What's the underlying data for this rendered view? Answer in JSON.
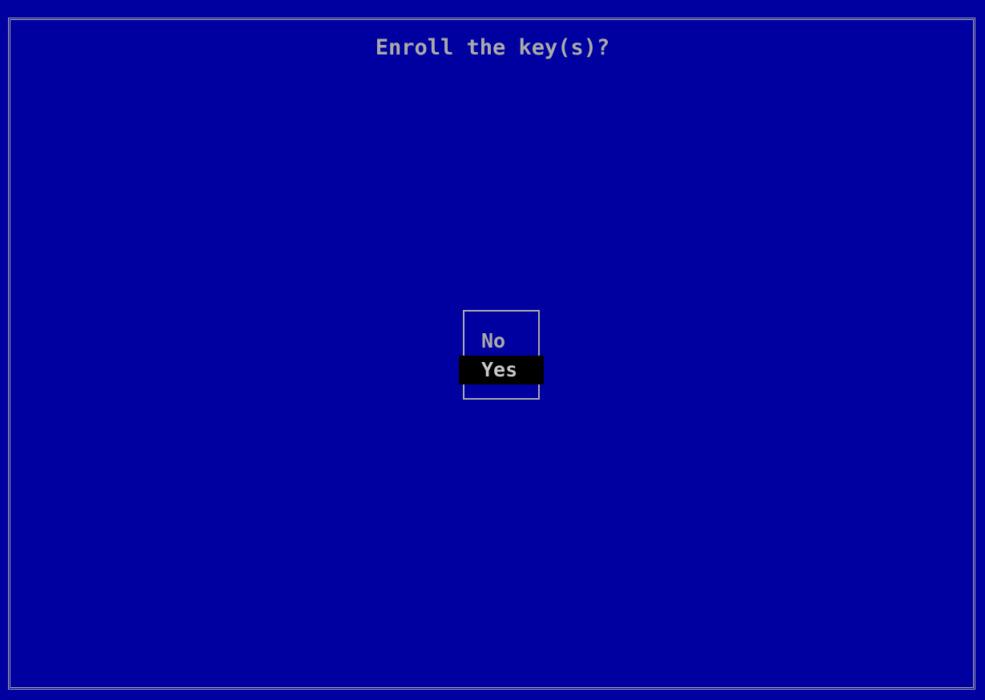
{
  "dialog": {
    "title": "Enroll the key(s)?",
    "options": [
      {
        "label": "No",
        "selected": false
      },
      {
        "label": "Yes",
        "selected": true
      }
    ]
  },
  "colors": {
    "background": "#0000a0",
    "foreground": "#aaaaaa",
    "highlight_background": "#000000"
  }
}
